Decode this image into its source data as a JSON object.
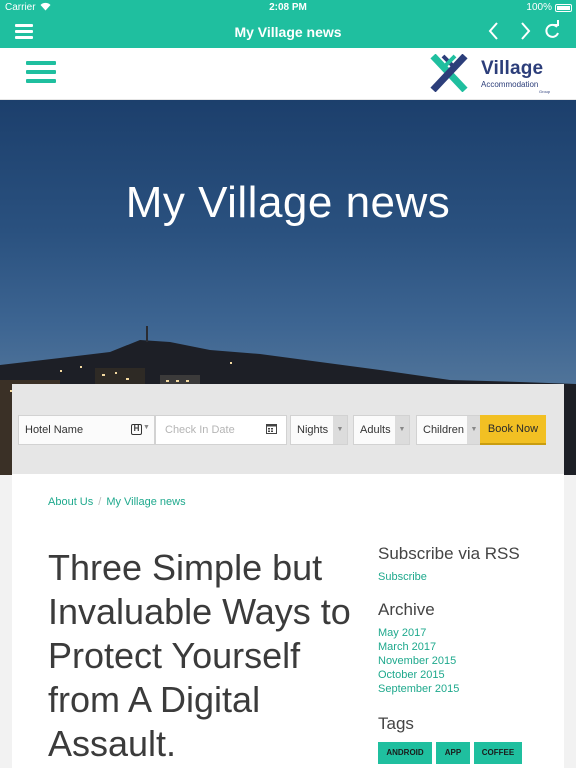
{
  "status_bar": {
    "carrier": "Carrier",
    "time": "2:08 PM",
    "battery": "100%"
  },
  "app_bar": {
    "title": "My Village news",
    "back_icon": "chevron-left-icon",
    "forward_icon": "chevron-right-icon",
    "refresh_icon": "refresh-icon",
    "menu_icon": "menu-icon"
  },
  "site_header": {
    "menu_icon": "hamburger-icon",
    "logo": {
      "name": "Village",
      "line2": "Accommodation",
      "line3": "Group"
    }
  },
  "hero": {
    "title": "My Village news"
  },
  "booking": {
    "hotel_placeholder": "Hotel Name",
    "checkin_placeholder": "Check In Date",
    "nights_label": "Nights",
    "adults_label": "Adults",
    "children_label": "Children",
    "book_label": "Book Now"
  },
  "breadcrumb": {
    "parent": "About Us",
    "separator": "/",
    "current": "My Village news"
  },
  "article": {
    "title": "Three Simple but Invaluable Ways to Protect Yourself from A Digital Assault."
  },
  "sidebar": {
    "rss_heading": "Subscribe via RSS",
    "rss_link": "Subscribe",
    "archive_heading": "Archive",
    "archive_items": [
      "May 2017",
      "March 2017",
      "November 2015",
      "October 2015",
      "September 2015"
    ],
    "tags_heading": "Tags",
    "tags": [
      "ANDROID",
      "APP",
      "COFFEE"
    ]
  },
  "colors": {
    "accent": "#1fbf9f",
    "link": "#1fa98d",
    "book_button": "#f2c023",
    "brand_navy": "#2c3e7a"
  }
}
